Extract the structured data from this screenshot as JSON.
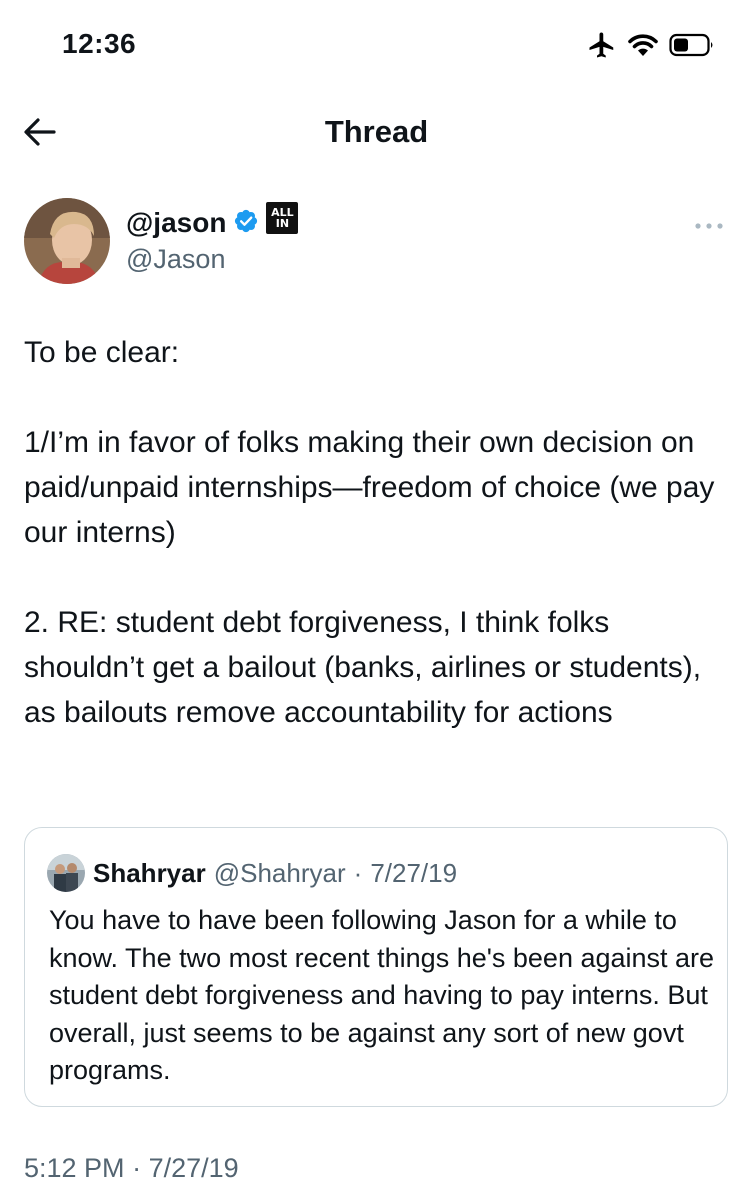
{
  "status_bar": {
    "time": "12:36",
    "icons": [
      "airplane-icon",
      "wifi-icon",
      "battery-icon"
    ]
  },
  "nav": {
    "back_icon": "arrow-left-icon",
    "title": "Thread"
  },
  "tweet": {
    "display_name": "@jason",
    "handle": "@Jason",
    "verified_icon": "verified-badge-icon",
    "affiliation_badge": {
      "line1": "ALL",
      "line2": "IN"
    },
    "more_icon": "more-icon",
    "text": "To be clear:\n\n1/I’m in favor of folks making their own decision on paid/unpaid internships—freedom of choice (we pay our interns)\n\n2. RE: student debt forgiveness, I think folks shouldn’t get a bailout (banks, airlines or students), as bailouts remove accountability for actions",
    "time": "5:12 PM",
    "separator": "·",
    "date": "7/27/19"
  },
  "quote": {
    "display_name": "Shahryar",
    "handle": "@Shahryar",
    "separator": "·",
    "date": "7/27/19",
    "text": "You have to have been following Jason for a while to know. The two most recent things he's been against are student debt forgiveness and having to pay interns. But overall, just seems to be against any sort of new govt programs."
  },
  "colors": {
    "text_primary": "#0f1419",
    "text_secondary": "#536471",
    "verified_blue": "#1d9bf0",
    "border": "#cfd9de"
  }
}
